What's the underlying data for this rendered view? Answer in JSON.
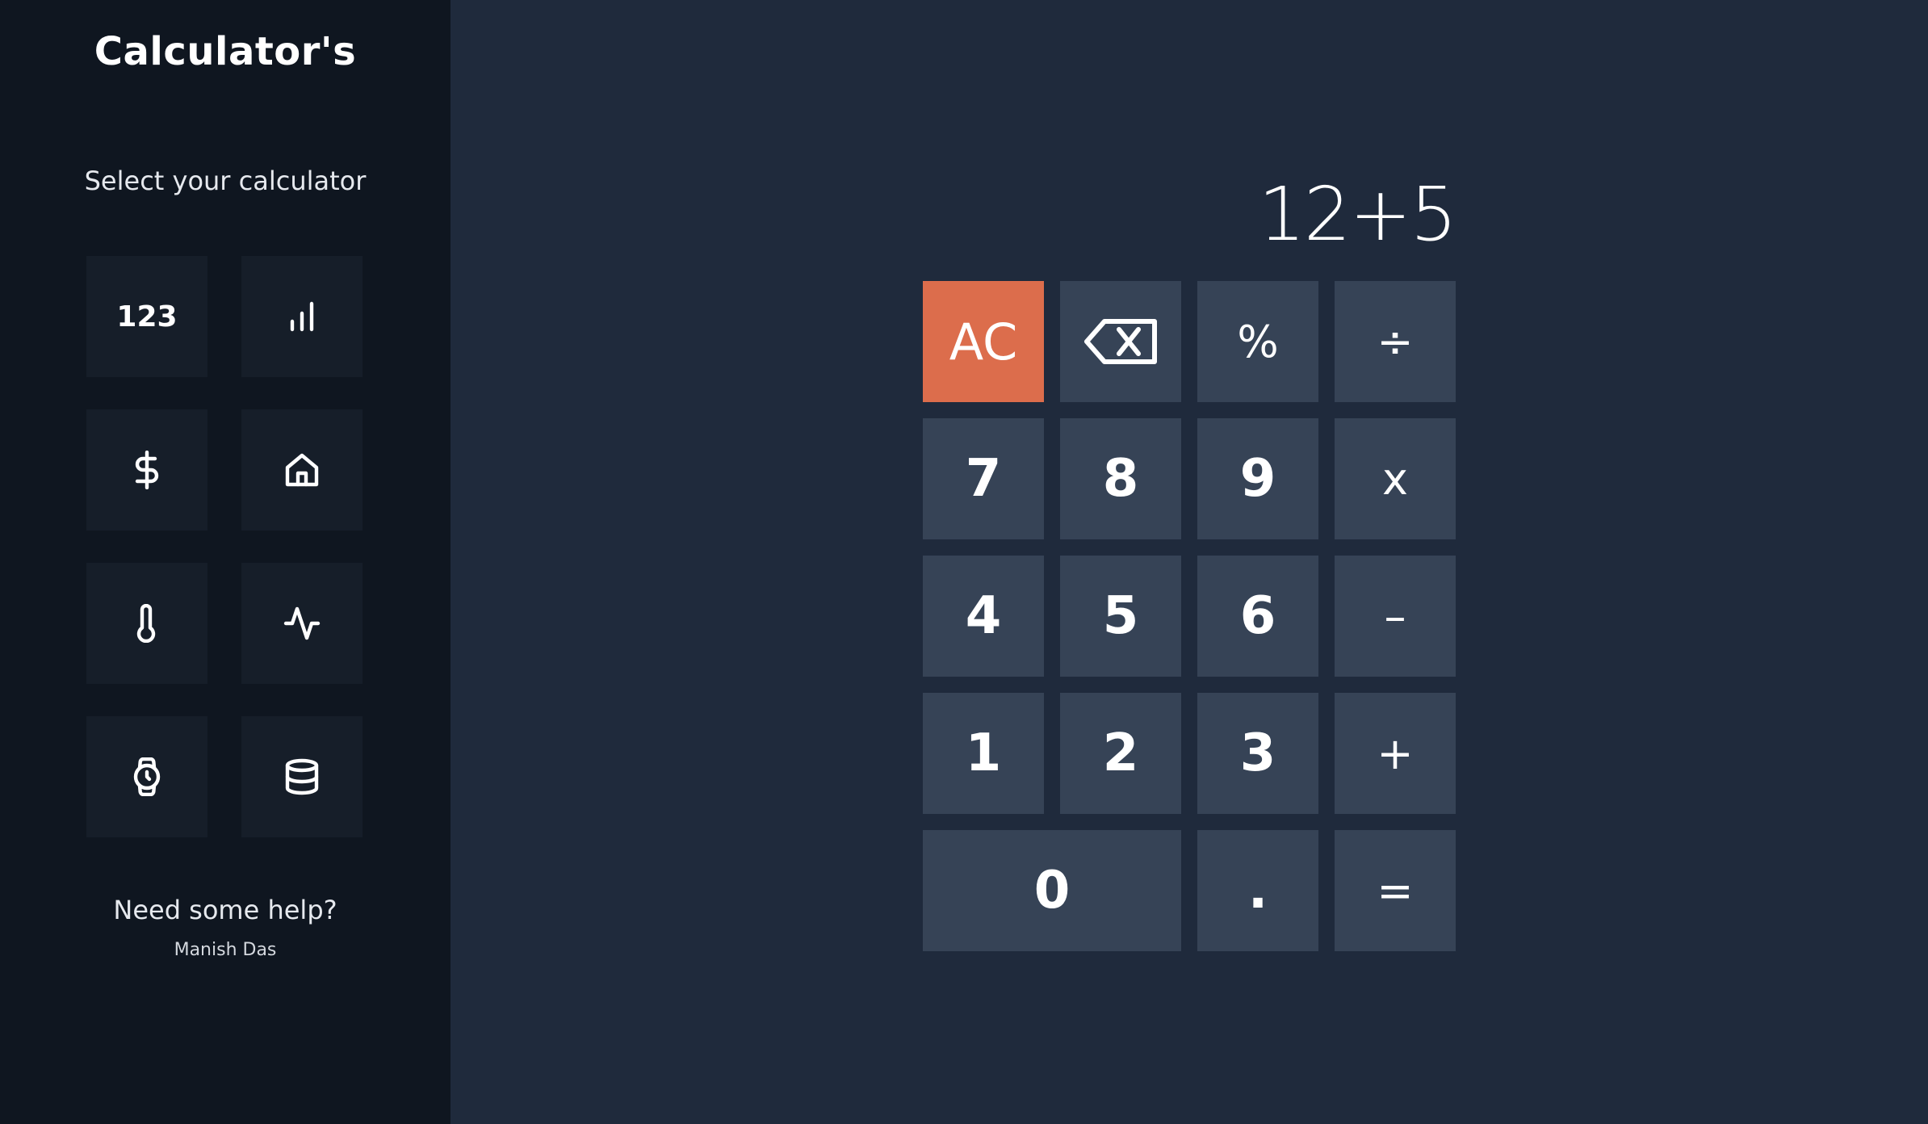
{
  "sidebar": {
    "title": "Calculator's",
    "select_label": "Select your calculator",
    "tiles": [
      {
        "label": "123",
        "icon": "numbers-icon"
      },
      {
        "icon": "bar-chart-icon"
      },
      {
        "icon": "dollar-icon"
      },
      {
        "icon": "home-icon"
      },
      {
        "icon": "thermometer-icon"
      },
      {
        "icon": "activity-icon"
      },
      {
        "icon": "watch-icon"
      },
      {
        "icon": "database-icon"
      }
    ],
    "help_title": "Need some help?",
    "help_author": "Manish Das"
  },
  "calculator": {
    "display": "12+5",
    "keys": {
      "ac": "AC",
      "percent": "%",
      "divide": "÷",
      "seven": "7",
      "eight": "8",
      "nine": "9",
      "multiply": "x",
      "four": "4",
      "five": "5",
      "six": "6",
      "minus": "–",
      "one": "1",
      "two": "2",
      "three": "3",
      "plus": "+",
      "zero": "0",
      "decimal": ".",
      "equals": "="
    },
    "backspace_icon": "backspace-icon"
  },
  "colors": {
    "background": "#1f2a3c",
    "sidebar": "#0f1620",
    "tile": "#161e29",
    "key": "#364356",
    "accent": "#dc6d4c"
  }
}
